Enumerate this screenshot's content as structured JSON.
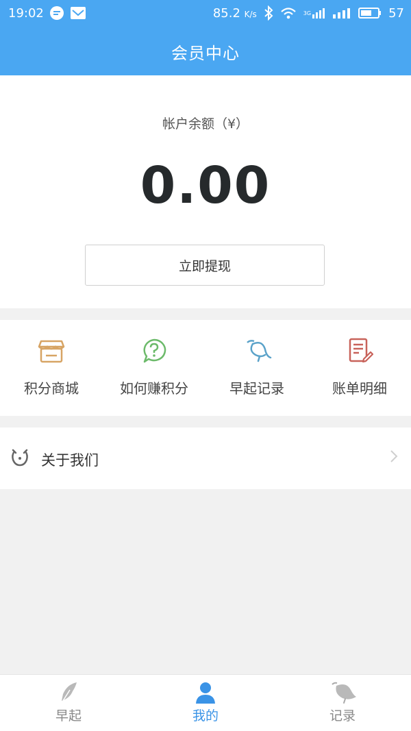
{
  "status_bar": {
    "time": "19:02",
    "speed": "85.2",
    "speed_unit": "K/s",
    "net_type": "3G",
    "battery": "57"
  },
  "header": {
    "title": "会员中心"
  },
  "balance": {
    "label": "帐户余额（¥）",
    "amount": "0.00",
    "withdraw_label": "立即提现"
  },
  "menu": {
    "items": [
      {
        "label": "积分商城",
        "icon": "shop-icon"
      },
      {
        "label": "如何赚积分",
        "icon": "question-bubble-icon"
      },
      {
        "label": "早起记录",
        "icon": "bird-icon"
      },
      {
        "label": "账单明细",
        "icon": "bill-icon"
      }
    ]
  },
  "about": {
    "label": "关于我们",
    "icon": "horseshoe-icon"
  },
  "tabbar": {
    "items": [
      {
        "label": "早起",
        "icon": "feather-icon",
        "active": false
      },
      {
        "label": "我的",
        "icon": "user-icon",
        "active": true
      },
      {
        "label": "记录",
        "icon": "bird-icon",
        "active": false
      }
    ]
  },
  "colors": {
    "primary": "#4aa7f2",
    "active_tab": "#3a93e6",
    "shop_icon": "#d7a464",
    "question_icon": "#6cba6a",
    "bird_icon": "#5aa2c9",
    "bill_icon": "#c8625a"
  }
}
